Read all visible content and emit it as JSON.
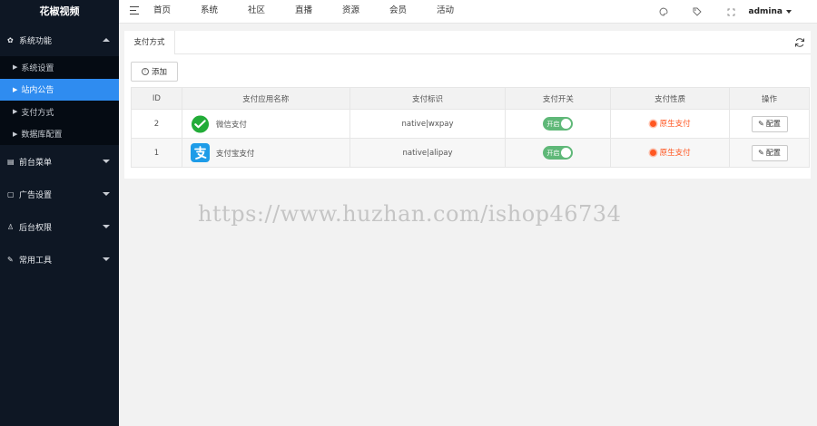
{
  "app": {
    "title": "花椒视频"
  },
  "sidebar": {
    "groups": [
      {
        "label": "系统功能",
        "icon": "gear-icon",
        "expanded": true,
        "items": [
          {
            "label": "系统设置",
            "active": false
          },
          {
            "label": "站内公告",
            "active": true
          },
          {
            "label": "支付方式",
            "active": false
          },
          {
            "label": "数据库配置",
            "active": false
          }
        ]
      },
      {
        "label": "前台菜单",
        "icon": "grid-icon",
        "expanded": false
      },
      {
        "label": "广告设置",
        "icon": "ad-icon",
        "expanded": false
      },
      {
        "label": "后台权限",
        "icon": "user-lock-icon",
        "expanded": false
      },
      {
        "label": "常用工具",
        "icon": "wrench-icon",
        "expanded": false
      }
    ]
  },
  "header": {
    "nav": [
      "首页",
      "系统",
      "社区",
      "直播",
      "资源",
      "会员",
      "活动"
    ],
    "icons": [
      "palette-icon",
      "tag-icon",
      "fullscreen-icon"
    ],
    "user": "admina"
  },
  "main": {
    "tab": "支付方式",
    "add_label": "添加",
    "columns": [
      "ID",
      "支付应用名称",
      "支付标识",
      "支付开关",
      "支付性质",
      "操作"
    ],
    "rows": [
      {
        "id": "2",
        "name": "微信支付",
        "icon": "wechat-pay-icon",
        "ident": "native|wxpay",
        "switch": "开启",
        "nature": "原生支付",
        "action": "配置"
      },
      {
        "id": "1",
        "name": "支付宝支付",
        "icon": "alipay-icon",
        "ident": "native|alipay",
        "switch": "开启",
        "nature": "原生支付",
        "action": "配置"
      }
    ]
  },
  "watermark": "https://www.huzhan.com/ishop46734",
  "colors": {
    "sidebar_bg": "#0e1724",
    "accent": "#2f8cf0",
    "switch_on": "#5fb878",
    "nature": "#ff5722"
  }
}
